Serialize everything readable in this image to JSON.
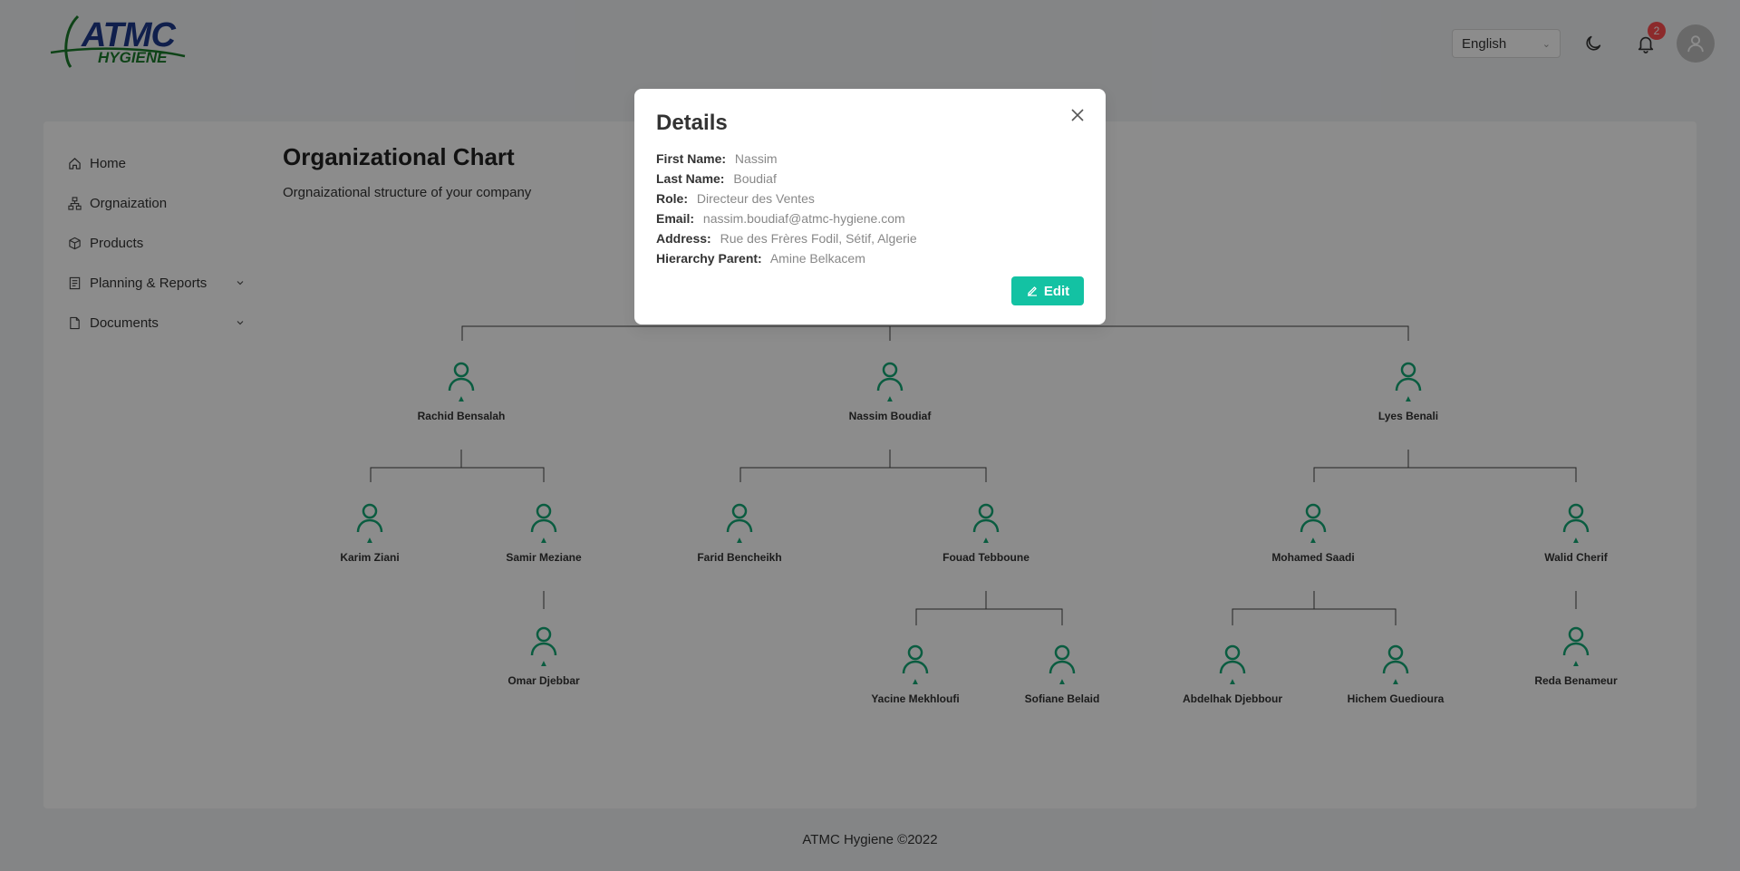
{
  "header": {
    "logo_text": "ATMC",
    "logo_sub": "HYGIENE",
    "language": "English",
    "notification_count": "2"
  },
  "sidebar": {
    "items": [
      {
        "label": "Home",
        "icon": "home-icon"
      },
      {
        "label": "Orgnaization",
        "icon": "org-icon"
      },
      {
        "label": "Products",
        "icon": "products-icon"
      },
      {
        "label": "Planning & Reports",
        "icon": "planning-icon"
      },
      {
        "label": "Documents",
        "icon": "documents-icon"
      }
    ]
  },
  "page": {
    "title": "Organizational Chart",
    "subtitle": "Orgnaizational structure of your company"
  },
  "org": {
    "level1": [
      "Rachid Bensalah",
      "Nassim Boudiaf",
      "Lyes Benali"
    ],
    "level2": [
      "Karim Ziani",
      "Samir Meziane",
      "Farid Bencheikh",
      "Fouad Tebboune",
      "Mohamed Saadi",
      "Walid Cherif"
    ],
    "level3": [
      "Omar Djebbar",
      "Reda Benameur"
    ],
    "level4": [
      "Yacine Mekhloufi",
      "Sofiane Belaid",
      "Abdelhak Djebbour",
      "Hichem Guedioura"
    ],
    "accent_color": "#13a876"
  },
  "modal": {
    "title": "Details",
    "fields": [
      {
        "label": "First Name:",
        "value": "Nassim"
      },
      {
        "label": "Last Name:",
        "value": "Boudiaf"
      },
      {
        "label": "Role:",
        "value": "Directeur des Ventes"
      },
      {
        "label": "Email:",
        "value": "nassim.boudiaf@atmc-hygiene.com"
      },
      {
        "label": "Address:",
        "value": "Rue des Frères Fodil, Sétif, Algerie"
      },
      {
        "label": "Hierarchy Parent:",
        "value": "Amine Belkacem"
      }
    ],
    "edit_label": "Edit"
  },
  "footer": {
    "text": "ATMC Hygiene ©2022"
  }
}
